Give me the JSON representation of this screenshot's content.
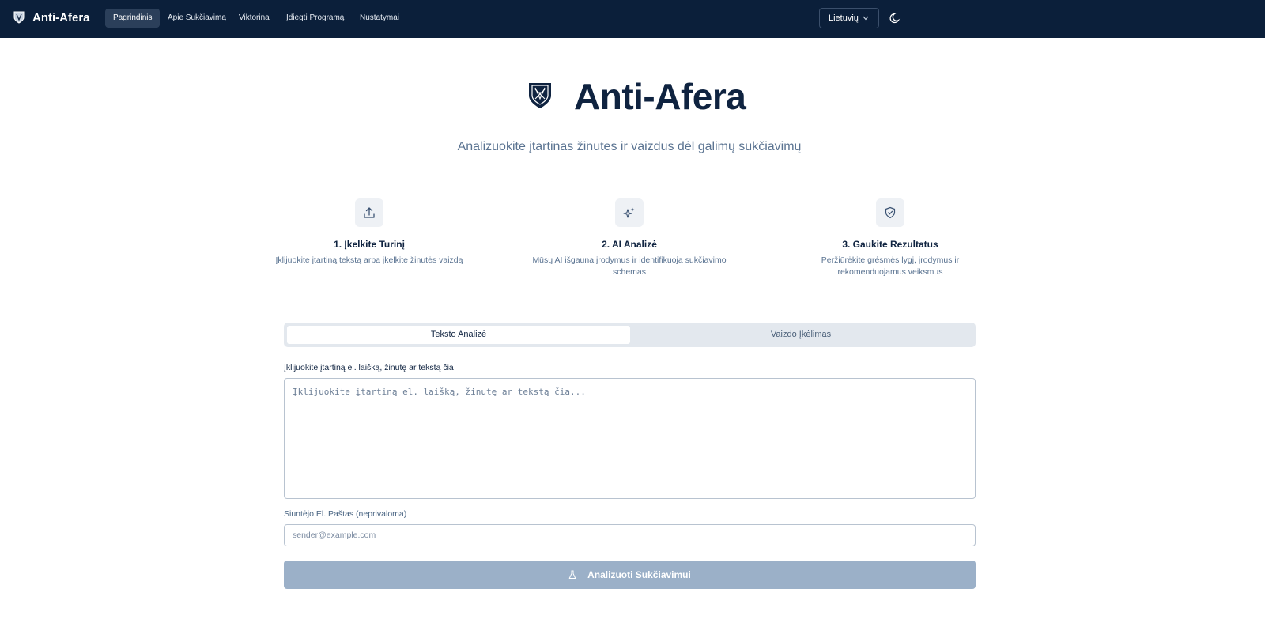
{
  "navbar": {
    "brand": "Anti-Afera",
    "items": [
      {
        "label": "Pagrindinis",
        "active": true
      },
      {
        "label": "Apie Sukčiavimą",
        "active": false
      },
      {
        "label": "Viktorina",
        "active": false
      },
      {
        "label": "Įdiegti Programą",
        "active": false
      },
      {
        "label": "Nustatymai",
        "active": false
      }
    ],
    "language": "Lietuvių",
    "theme_icon": "moon-icon"
  },
  "hero": {
    "title": "Anti-Afera",
    "subtitle": "Analizuokite įtartinas žinutes ir vaizdus dėl galimų sukčiavimų",
    "logo_icon": "shield-logo-icon"
  },
  "steps": [
    {
      "icon": "upload-icon",
      "title": "1. Įkelkite Turinį",
      "description": "Įklijuokite įtartiną tekstą arba įkelkite žinutės vaizdą"
    },
    {
      "icon": "sparkles-icon",
      "title": "2. AI Analizė",
      "description": "Mūsų AI išgauna įrodymus ir identifikuoja sukčiavimo schemas"
    },
    {
      "icon": "shield-check-icon",
      "title": "3. Gaukite Rezultatus",
      "description": "Peržiūrėkite grėsmės lygį, įrodymus ir rekomenduojamus veiksmus"
    }
  ],
  "tabs": [
    {
      "label": "Teksto Analizė",
      "active": true
    },
    {
      "label": "Vaizdo Įkėlimas",
      "active": false
    }
  ],
  "form": {
    "message_label": "Įklijuokite įtartiną el. laišką, žinutę ar tekstą čia",
    "message_placeholder": "Įklijuokite įtartiną el. laišką, žinutę ar tekstą čia...",
    "message_value": "",
    "email_label": "Siuntėjo El. Paštas (neprivaloma)",
    "email_placeholder": "sender@example.com",
    "email_value": "",
    "submit_label": "Analizuoti Sukčiavimui"
  },
  "colors": {
    "navbar_bg": "#0b1f3a",
    "primary_text": "#0f2340",
    "muted_text": "#5a7391",
    "disabled_button": "#9bb0c8"
  }
}
